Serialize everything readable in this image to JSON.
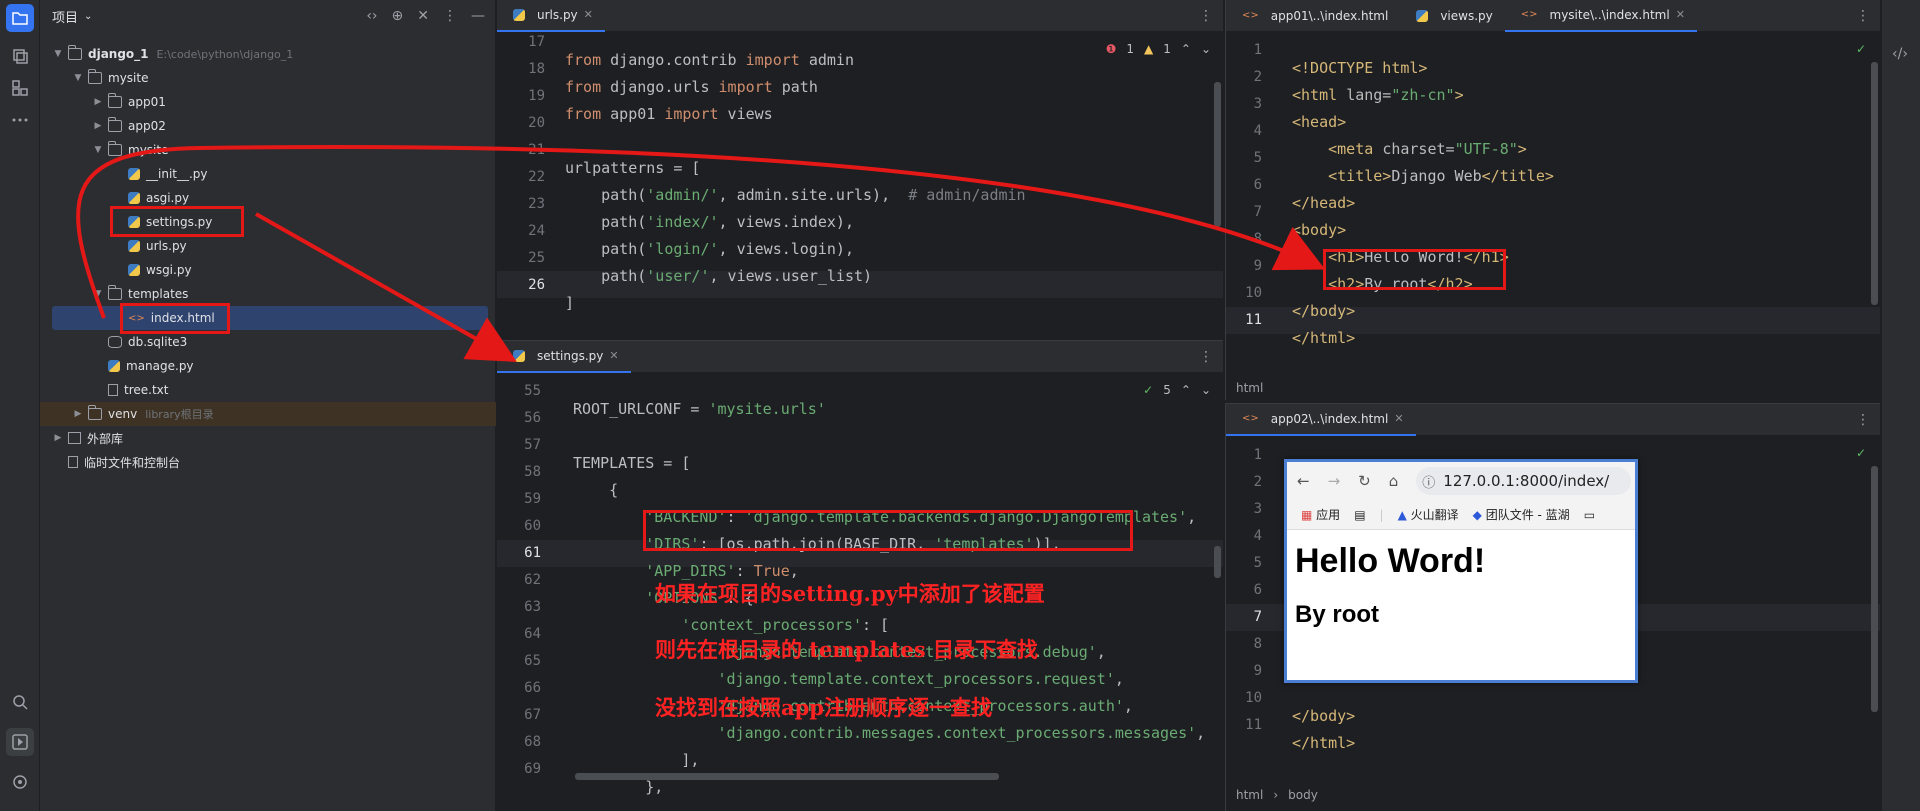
{
  "activity": {
    "icons": [
      "folder-icon",
      "packages-icon",
      "structure-icon",
      "more-icon",
      "search-icon",
      "run-icon",
      "git-icon"
    ]
  },
  "project": {
    "header": "项目",
    "tree": [
      {
        "name": "django_1",
        "hint": "E:\\code\\python\\django_1"
      },
      {
        "name": "mysite"
      },
      {
        "name": "app01"
      },
      {
        "name": "app02"
      },
      {
        "name": "mysite"
      },
      {
        "name": "__init__.py"
      },
      {
        "name": "asgi.py"
      },
      {
        "name": "settings.py"
      },
      {
        "name": "urls.py"
      },
      {
        "name": "wsgi.py"
      },
      {
        "name": "templates"
      },
      {
        "name": "index.html"
      },
      {
        "name": "db.sqlite3"
      },
      {
        "name": "manage.py"
      },
      {
        "name": "tree.txt"
      },
      {
        "name": "venv",
        "hint": "library根目录"
      },
      {
        "name": "外部库"
      },
      {
        "name": "临时文件和控制台"
      }
    ]
  },
  "urls_pane": {
    "tab": "urls.py",
    "inspections": {
      "errors": "1",
      "warnings": "1"
    },
    "lines": [
      "17",
      "18",
      "19",
      "20",
      "21",
      "22",
      "23",
      "24",
      "25",
      "26"
    ]
  },
  "settings_pane": {
    "tab": "settings.py",
    "inspections": {
      "checks": "5"
    },
    "lines": [
      "55",
      "56",
      "57",
      "58",
      "59",
      "60",
      "61",
      "62",
      "63",
      "64",
      "65",
      "66",
      "67",
      "68",
      "69"
    ]
  },
  "right_top": {
    "tabs": [
      "app01\\..\\index.html",
      "views.py",
      "mysite\\..\\index.html"
    ],
    "lines": [
      "1",
      "2",
      "3",
      "4",
      "5",
      "6",
      "7",
      "8",
      "9",
      "10",
      "11"
    ],
    "breadcrumb": "html"
  },
  "right_bottom": {
    "tab": "app02\\..\\index.html",
    "lines": [
      "1",
      "2",
      "3",
      "4",
      "5",
      "6",
      "7",
      "8",
      "9",
      "10",
      "11"
    ],
    "breadcrumb": [
      "html",
      "body"
    ]
  },
  "browser": {
    "url": "127.0.0.1:8000/index/",
    "bookmarks": [
      "应用",
      "火山翻译",
      "团队文件 - 蓝湖"
    ],
    "h1": "Hello Word!",
    "h2": "By root"
  },
  "annotations": [
    "如果在项目的setting.py中添加了该配置",
    "则先在根目录的 templates 目录下查找",
    "没找到在按照app注册顺序逐一查找"
  ]
}
